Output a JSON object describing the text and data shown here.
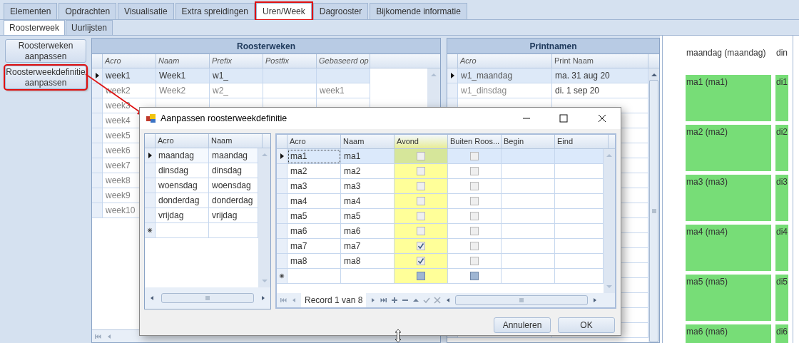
{
  "main_tabs": [
    {
      "label": "Elementen",
      "selected": false,
      "highlighted": false
    },
    {
      "label": "Opdrachten",
      "selected": false,
      "highlighted": false
    },
    {
      "label": "Visualisatie",
      "selected": false,
      "highlighted": false
    },
    {
      "label": "Extra spreidingen",
      "selected": false,
      "highlighted": false
    },
    {
      "label": "Uren/Week",
      "selected": true,
      "highlighted": true
    },
    {
      "label": "Dagrooster",
      "selected": false,
      "highlighted": false
    },
    {
      "label": "Bijkomende informatie",
      "selected": false,
      "highlighted": false
    }
  ],
  "sub_tabs": [
    {
      "label": "Roosterweek",
      "selected": true
    },
    {
      "label": "Uurlijsten",
      "selected": false
    }
  ],
  "side_buttons": [
    {
      "label": "Roosterweken aanpassen",
      "highlighted": false
    },
    {
      "label": "Roosterweekdefinitie aanpassen",
      "highlighted": true
    }
  ],
  "roosterweken": {
    "title": "Roosterweken",
    "columns": [
      {
        "label": "Acro",
        "italic": true
      },
      {
        "label": "Naam",
        "italic": true
      },
      {
        "label": "Prefix",
        "italic": true
      },
      {
        "label": "Postfix",
        "italic": true
      },
      {
        "label": "Gebaseerd op",
        "italic": true
      }
    ],
    "rows": [
      {
        "acro": "week1",
        "naam": "Week1",
        "prefix": "w1_",
        "selected": true
      },
      {
        "acro": "week2",
        "naam": "Week2",
        "prefix": "w2_",
        "gebaseerd_op": "week1",
        "selected": false
      },
      {
        "acro": "week3",
        "selected": false
      },
      {
        "acro": "week4",
        "selected": false
      },
      {
        "acro": "week5",
        "selected": false
      },
      {
        "acro": "week6",
        "selected": false
      },
      {
        "acro": "week7",
        "selected": false
      },
      {
        "acro": "week8",
        "selected": false
      },
      {
        "acro": "week9",
        "selected": false
      },
      {
        "acro": "week10",
        "selected": false
      }
    ]
  },
  "printnamen": {
    "title": "Printnamen",
    "columns": [
      {
        "label": "Acro",
        "italic": true
      },
      {
        "label": "Print Naam",
        "italic": false
      }
    ],
    "rows": [
      {
        "acro": "w1_maandag",
        "print_naam": "ma. 31 aug 20",
        "selected": true
      },
      {
        "acro": "w1_dinsdag",
        "print_naam": "di. 1 sep 20",
        "selected": false
      }
    ]
  },
  "schedule": {
    "columns": [
      {
        "header": "maandag (maandag)",
        "blocks": [
          "ma1 (ma1)",
          "ma2 (ma2)",
          "ma3 (ma3)",
          "ma4 (ma4)",
          "ma5 (ma5)",
          "ma6 (ma6)"
        ]
      },
      {
        "header": "din",
        "blocks": [
          "di1",
          "di2",
          "di3",
          "di4",
          "di5",
          "di6"
        ]
      }
    ]
  },
  "dialog": {
    "title": "Aanpassen roosterweekdefinitie",
    "days": {
      "columns": [
        "Acro",
        "Naam"
      ],
      "rows": [
        {
          "acro": "maandag",
          "naam": "maandag",
          "selected": true
        },
        {
          "acro": "dinsdag",
          "naam": "dinsdag",
          "selected": false
        },
        {
          "acro": "woensdag",
          "naam": "woensdag",
          "selected": false
        },
        {
          "acro": "donderdag",
          "naam": "donderdag",
          "selected": false
        },
        {
          "acro": "vrijdag",
          "naam": "vrijdag",
          "selected": false
        }
      ]
    },
    "periods": {
      "columns": [
        {
          "label": "Acro",
          "highlighted": false
        },
        {
          "label": "Naam",
          "highlighted": false
        },
        {
          "label": "Avond",
          "highlighted": true
        },
        {
          "label": "Buiten Roos...",
          "highlighted": false
        },
        {
          "label": "Begin",
          "highlighted": false
        },
        {
          "label": "Eind",
          "highlighted": false
        }
      ],
      "rows": [
        {
          "acro": "ma1",
          "naam": "ma1",
          "avond": false,
          "buiten_rooster": false,
          "selected": true
        },
        {
          "acro": "ma2",
          "naam": "ma2",
          "avond": false,
          "buiten_rooster": false,
          "selected": false
        },
        {
          "acro": "ma3",
          "naam": "ma3",
          "avond": false,
          "buiten_rooster": false,
          "selected": false
        },
        {
          "acro": "ma4",
          "naam": "ma4",
          "avond": false,
          "buiten_rooster": false,
          "selected": false
        },
        {
          "acro": "ma5",
          "naam": "ma5",
          "avond": false,
          "buiten_rooster": false,
          "selected": false
        },
        {
          "acro": "ma6",
          "naam": "ma6",
          "avond": false,
          "buiten_rooster": false,
          "selected": false
        },
        {
          "acro": "ma7",
          "naam": "ma7",
          "avond": true,
          "buiten_rooster": false,
          "selected": false
        },
        {
          "acro": "ma8",
          "naam": "ma8",
          "avond": true,
          "buiten_rooster": false,
          "selected": false
        }
      ],
      "new_row": {
        "avond_indeterminate": true,
        "buiten_rooster_indeterminate": true
      },
      "record": "Record 1 van 8"
    },
    "buttons": [
      "Annuleren",
      "OK"
    ]
  }
}
